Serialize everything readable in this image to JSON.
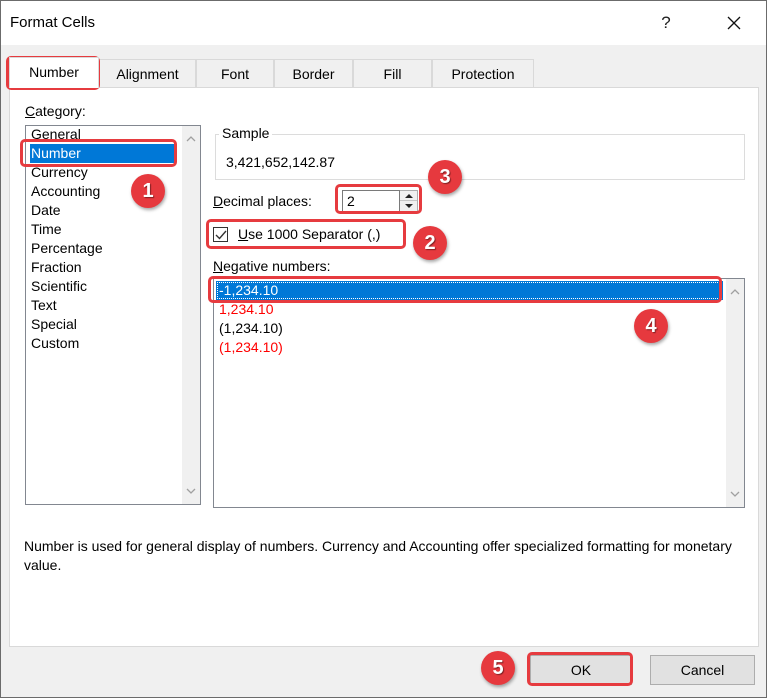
{
  "window": {
    "title": "Format Cells",
    "help_label": "?",
    "close_icon": "close-icon"
  },
  "tabs": [
    {
      "label": "Number",
      "active": true
    },
    {
      "label": "Alignment",
      "active": false
    },
    {
      "label": "Font",
      "active": false
    },
    {
      "label": "Border",
      "active": false
    },
    {
      "label": "Fill",
      "active": false
    },
    {
      "label": "Protection",
      "active": false
    }
  ],
  "category": {
    "label_mnemonic": "C",
    "label_rest": "ategory:",
    "items": [
      "General",
      "Number",
      "Currency",
      "Accounting",
      "Date",
      "Time",
      "Percentage",
      "Fraction",
      "Scientific",
      "Text",
      "Special",
      "Custom"
    ],
    "selected": "Number"
  },
  "sample": {
    "legend": "Sample",
    "value": "3,421,652,142.87"
  },
  "decimal_places": {
    "label_mnemonic": "D",
    "label_rest": "ecimal places:",
    "value": "2"
  },
  "separator": {
    "label_mnemonic": "U",
    "label_rest": "se 1000 Separator (,)",
    "checked": true
  },
  "negative_numbers": {
    "label_mnemonic": "N",
    "label_rest": "egative numbers:",
    "items": [
      {
        "text": "-1,234.10",
        "color": "#000000",
        "selected": true
      },
      {
        "text": "1,234.10",
        "color": "#ff0000",
        "selected": false
      },
      {
        "text": "(1,234.10)",
        "color": "#000000",
        "selected": false
      },
      {
        "text": "(1,234.10)",
        "color": "#ff0000",
        "selected": false
      }
    ]
  },
  "description": "Number is used for general display of numbers.  Currency and Accounting offer specialized formatting for monetary value.",
  "buttons": {
    "ok": "OK",
    "cancel": "Cancel"
  },
  "annotations": {
    "color": "#e63b3f",
    "steps": [
      "1",
      "2",
      "3",
      "4",
      "5"
    ]
  }
}
